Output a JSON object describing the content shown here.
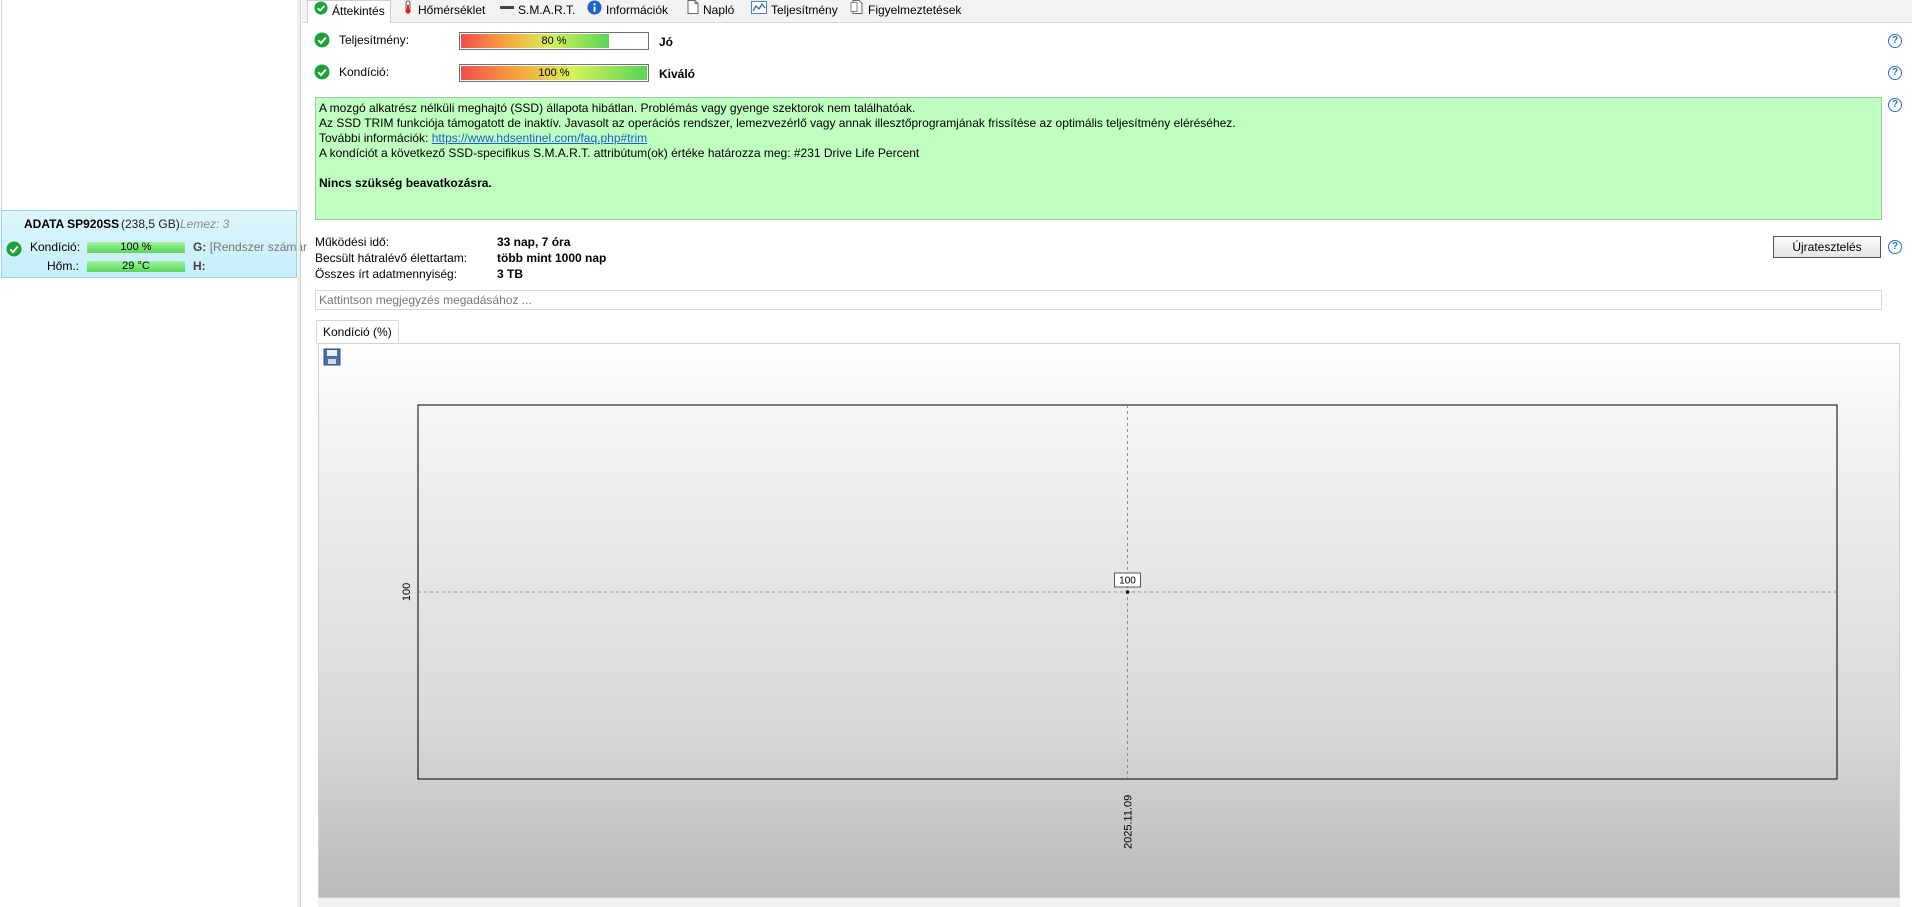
{
  "sidebar": {
    "disk": {
      "name": "ADATA SP920SS",
      "size": "(238,5 GB)",
      "disk_no": "Lemez: 3",
      "health_label": "Kondíció:",
      "health_value": "100 %",
      "health_percent": 100,
      "temp_label": "Hőm.:",
      "temp_value": "29 °C",
      "drive_g_letter": "G:",
      "drive_g_label": "[Rendszer számár",
      "drive_h_letter": "H:"
    }
  },
  "tabs": [
    {
      "label": "Áttekintés",
      "icon": "check-circle-icon",
      "active": true
    },
    {
      "label": "Hőmérséklet",
      "icon": "thermometer-icon"
    },
    {
      "label": "S.M.A.R.T.",
      "icon": "dash-icon"
    },
    {
      "label": "Információk",
      "icon": "info-icon"
    },
    {
      "label": "Napló",
      "icon": "document-icon"
    },
    {
      "label": "Teljesítmény",
      "icon": "chart-icon"
    },
    {
      "label": "Figyelmeztetések",
      "icon": "warning-doc-icon"
    }
  ],
  "status": {
    "performance": {
      "label": "Teljesítmény:",
      "value": "80 %",
      "percent": 80,
      "rating": "Jó"
    },
    "health": {
      "label": "Kondíció:",
      "value": "100 %",
      "percent": 100,
      "rating": "Kiváló"
    }
  },
  "info": {
    "line1": "A mozgó alkatrész nélküli meghajtó (SSD) állapota hibátlan. Problémás vagy gyenge szektorok nem találhatóak.",
    "line2": "Az SSD TRIM funkciója támogatott de inaktív. Javasolt az operációs rendszer, lemezvezérlő vagy annak illesztőprogramjának frissítése az optimális teljesítmény eléréséhez.",
    "more_label": "További információk:",
    "link": "https://www.hdsentinel.com/faq.php#trim",
    "line4": "A kondíciót a következő SSD-specifikus S.M.A.R.T. attribútum(ok) értéke határozza meg:  #231 Drive Life Percent",
    "conclusion": "Nincs szükség beavatkozásra."
  },
  "details": {
    "uptime_label": "Működési idő:",
    "uptime_value": "33 nap, 7 óra",
    "remaining_label": "Becsült hátralévő élettartam:",
    "remaining_value": "több mint 1000 nap",
    "written_label": "Összes írt adatmennyiség:",
    "written_value": "3 TB",
    "retest_button": "Újratesztelés",
    "note_placeholder": "Kattintson megjegyzés megadásához ..."
  },
  "chart_tab": "Kondíció  (%)",
  "colors": {
    "ok_green": "#1aa33a",
    "info_bg": "#bfffc0",
    "selected_disk_bg": "#c5eef9",
    "link": "#1a5fd0"
  },
  "chart_data": {
    "type": "line",
    "title": "",
    "x": [
      "2025.11.09"
    ],
    "series": [
      {
        "values": [
          100
        ]
      }
    ],
    "y_ticks": [
      100
    ],
    "data_labels": [
      "100"
    ],
    "grid": true
  }
}
